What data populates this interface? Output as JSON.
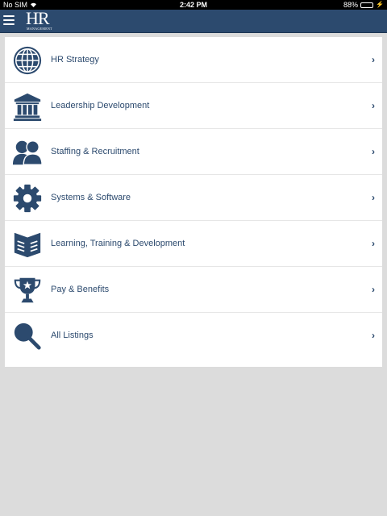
{
  "status_bar": {
    "carrier": "No SIM",
    "time": "2:42 PM",
    "battery": "88%",
    "battery_level": 0.88
  },
  "header": {
    "logo_main": "HR",
    "logo_sub": "MANAGEMENT",
    "menu_icon": "hamburger-icon"
  },
  "menu": {
    "items": [
      {
        "label": "HR Strategy",
        "icon": "globe-icon"
      },
      {
        "label": "Leadership Development",
        "icon": "institution-icon"
      },
      {
        "label": "Staffing & Recruitment",
        "icon": "people-icon"
      },
      {
        "label": "Systems & Software",
        "icon": "gear-icon"
      },
      {
        "label": "Learning, Training & Development",
        "icon": "book-icon"
      },
      {
        "label": "Pay & Benefits",
        "icon": "trophy-icon"
      },
      {
        "label": "All Listings",
        "icon": "search-icon"
      }
    ],
    "chevron": "›"
  },
  "colors": {
    "brand": "#2c4a6e",
    "background": "#dcdcdc",
    "panel": "#ffffff"
  }
}
